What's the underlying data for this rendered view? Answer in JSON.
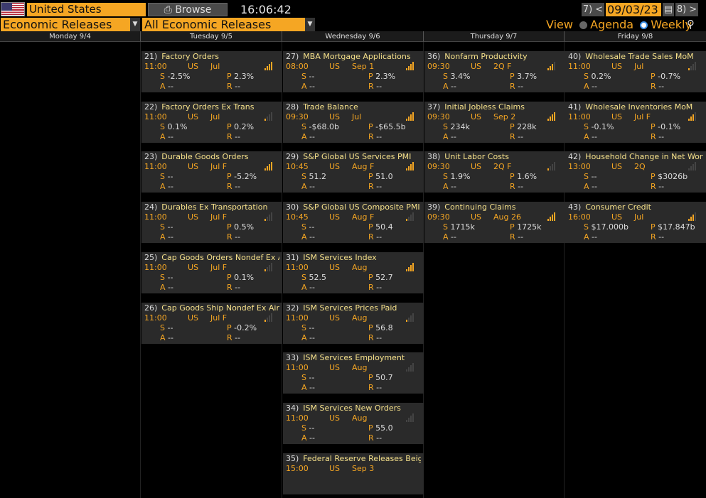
{
  "header": {
    "country": "United States",
    "browse_label": "Browse",
    "clock": "16:06:42",
    "prev_label": "7) <",
    "date": "09/03/23",
    "next_label": "8) >"
  },
  "filters": {
    "category": "Economic Releases",
    "subcategory": "All Economic Releases",
    "view_label": "View",
    "agenda_label": "Agenda",
    "weekly_label": "Weekly",
    "selected_view": "Weekly"
  },
  "days": [
    "Monday 9/4",
    "Tuesday 9/5",
    "Wednesday 9/6",
    "Thursday 9/7",
    "Friday 9/8"
  ],
  "events": [
    {
      "col": 1,
      "row": 0,
      "idx": "21)",
      "title": "Factory Orders",
      "time": "11:00",
      "country": "US",
      "period": "Jul",
      "S": "-2.5%",
      "P": "2.3%",
      "A": "--",
      "R": "--",
      "bars": 4
    },
    {
      "col": 1,
      "row": 1,
      "idx": "22)",
      "title": "Factory Orders Ex Trans",
      "time": "11:00",
      "country": "US",
      "period": "Jul",
      "S": "0.1%",
      "P": "0.2%",
      "A": "--",
      "R": "--",
      "bars": 1
    },
    {
      "col": 1,
      "row": 2,
      "idx": "23)",
      "title": "Durable Goods Orders",
      "time": "11:00",
      "country": "US",
      "period": "Jul F",
      "S": "--",
      "P": "-5.2%",
      "A": "--",
      "R": "--",
      "bars": 4
    },
    {
      "col": 1,
      "row": 3,
      "idx": "24)",
      "title": "Durables Ex Transportation",
      "time": "11:00",
      "country": "US",
      "period": "Jul F",
      "S": "--",
      "P": "0.5%",
      "A": "--",
      "R": "--",
      "bars": 1
    },
    {
      "col": 1,
      "row": 4,
      "idx": "25)",
      "title": "Cap Goods Orders Nondef Ex Air",
      "time": "11:00",
      "country": "US",
      "period": "Jul F",
      "S": "--",
      "P": "0.1%",
      "A": "--",
      "R": "--",
      "bars": 1
    },
    {
      "col": 1,
      "row": 5,
      "idx": "26)",
      "title": "Cap Goods Ship Nondef Ex Air",
      "time": "11:00",
      "country": "US",
      "period": "Jul F",
      "S": "--",
      "P": "-0.2%",
      "A": "--",
      "R": "--",
      "bars": 1
    },
    {
      "col": 2,
      "row": 0,
      "idx": "27)",
      "title": "MBA Mortgage Applications",
      "time": "08:00",
      "country": "US",
      "period": "Sep 1",
      "S": "--",
      "P": "2.3%",
      "A": "--",
      "R": "--",
      "bars": 4
    },
    {
      "col": 2,
      "row": 1,
      "idx": "28)",
      "title": "Trade Balance",
      "time": "09:30",
      "country": "US",
      "period": "Jul",
      "S": "-$68.0b",
      "P": "-$65.5b",
      "A": "--",
      "R": "--",
      "bars": 4
    },
    {
      "col": 2,
      "row": 2,
      "idx": "29)",
      "title": "S&P Global US Services PMI",
      "time": "10:45",
      "country": "US",
      "period": "Aug F",
      "S": "51.2",
      "P": "51.0",
      "A": "--",
      "R": "--",
      "bars": 4
    },
    {
      "col": 2,
      "row": 3,
      "idx": "30)",
      "title": "S&P Global US Composite PMI",
      "time": "10:45",
      "country": "US",
      "period": "Aug F",
      "S": "--",
      "P": "50.4",
      "A": "--",
      "R": "--",
      "bars": 1
    },
    {
      "col": 2,
      "row": 4,
      "idx": "31)",
      "title": "ISM Services Index",
      "time": "11:00",
      "country": "US",
      "period": "Aug",
      "S": "52.5",
      "P": "52.7",
      "A": "--",
      "R": "--",
      "bars": 4
    },
    {
      "col": 2,
      "row": 5,
      "idx": "32)",
      "title": "ISM Services Prices Paid",
      "time": "11:00",
      "country": "US",
      "period": "Aug",
      "S": "--",
      "P": "56.8",
      "A": "--",
      "R": "--",
      "bars": 1
    },
    {
      "col": 2,
      "row": 6,
      "idx": "33)",
      "title": "ISM Services Employment",
      "time": "11:00",
      "country": "US",
      "period": "Aug",
      "S": "--",
      "P": "50.7",
      "A": "--",
      "R": "--",
      "bars": 0
    },
    {
      "col": 2,
      "row": 7,
      "idx": "34)",
      "title": "ISM Services New Orders",
      "time": "11:00",
      "country": "US",
      "period": "Aug",
      "S": "--",
      "P": "55.0",
      "A": "--",
      "R": "--",
      "bars": 0
    },
    {
      "col": 2,
      "row": 8,
      "idx": "35)",
      "title": "Federal Reserve Releases Beig...",
      "time": "15:00",
      "country": "US",
      "period": "Sep 3",
      "S": "",
      "P": "",
      "A": "",
      "R": "",
      "bars": 0
    },
    {
      "col": 3,
      "row": 0,
      "idx": "36)",
      "title": "Nonfarm Productivity",
      "time": "09:30",
      "country": "US",
      "period": "2Q F",
      "S": "3.4%",
      "P": "3.7%",
      "A": "--",
      "R": "--",
      "bars": 3
    },
    {
      "col": 3,
      "row": 1,
      "idx": "37)",
      "title": "Initial Jobless Claims",
      "time": "09:30",
      "country": "US",
      "period": "Sep 2",
      "S": "234k",
      "P": "228k",
      "A": "--",
      "R": "--",
      "bars": 4
    },
    {
      "col": 3,
      "row": 2,
      "idx": "38)",
      "title": "Unit Labor Costs",
      "time": "09:30",
      "country": "US",
      "period": "2Q F",
      "S": "1.9%",
      "P": "1.6%",
      "A": "--",
      "R": "--",
      "bars": 1
    },
    {
      "col": 3,
      "row": 3,
      "idx": "39)",
      "title": "Continuing Claims",
      "time": "09:30",
      "country": "US",
      "period": "Aug 26",
      "S": "1715k",
      "P": "1725k",
      "A": "--",
      "R": "--",
      "bars": 4
    },
    {
      "col": 4,
      "row": 0,
      "idx": "40)",
      "title": "Wholesale Trade Sales MoM",
      "time": "11:00",
      "country": "US",
      "period": "Jul",
      "S": "0.2%",
      "P": "-0.7%",
      "A": "--",
      "R": "--",
      "bars": 1
    },
    {
      "col": 4,
      "row": 1,
      "idx": "41)",
      "title": "Wholesale Inventories MoM",
      "time": "11:00",
      "country": "US",
      "period": "Jul F",
      "S": "-0.1%",
      "P": "-0.1%",
      "A": "--",
      "R": "--",
      "bars": 3
    },
    {
      "col": 4,
      "row": 2,
      "idx": "42)",
      "title": "Household Change in Net Worth",
      "time": "13:00",
      "country": "US",
      "period": "2Q",
      "S": "--",
      "P": "$3026b",
      "A": "--",
      "R": "--",
      "bars": 0
    },
    {
      "col": 4,
      "row": 3,
      "idx": "43)",
      "title": "Consumer Credit",
      "time": "16:00",
      "country": "US",
      "period": "Jul",
      "S": "$17.000b",
      "P": "$17.847b",
      "A": "--",
      "R": "--",
      "bars": 3
    }
  ],
  "labels": {
    "S": "S",
    "P": "P",
    "A": "A",
    "R": "R"
  }
}
